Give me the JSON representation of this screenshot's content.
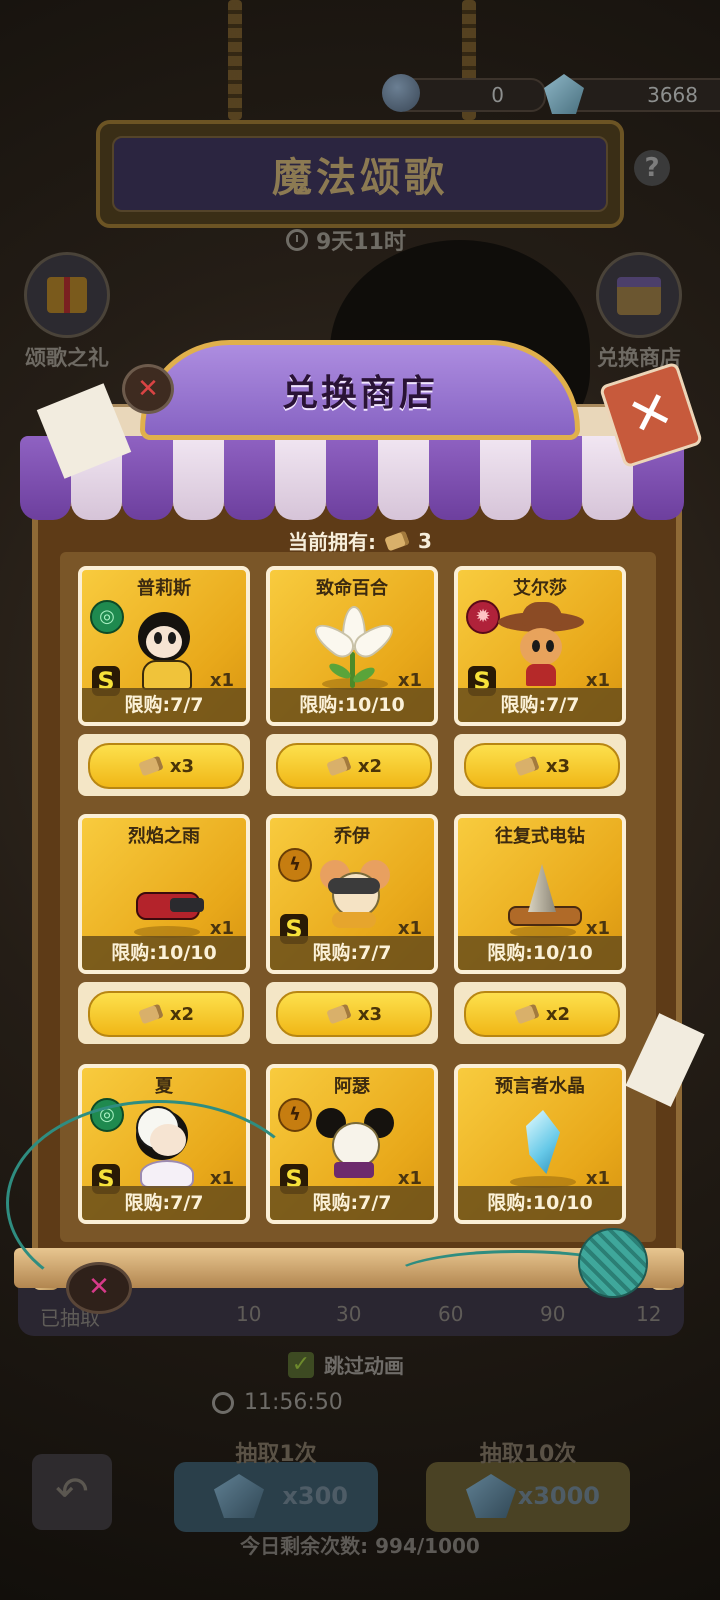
{
  "currency": {
    "orb_value": "0",
    "gem_value": "3668",
    "plus": "+"
  },
  "event": {
    "title": "魔法颂歌",
    "timer": "9天11时",
    "help": "?"
  },
  "side_buttons": {
    "left_label": "颂歌之礼",
    "right_label": "兑换商店"
  },
  "shop": {
    "title": "兑换商店",
    "owned_label": "当前拥有:",
    "owned_count": "3",
    "close_glyph": "✕",
    "items": [
      {
        "name": "普莉斯",
        "qty": "x1",
        "limit": "限购:7/7",
        "cost": "x3",
        "rank": "S",
        "element": "green"
      },
      {
        "name": "致命百合",
        "qty": "x1",
        "limit": "限购:10/10",
        "cost": "x2"
      },
      {
        "name": "艾尔莎",
        "qty": "x1",
        "limit": "限购:7/7",
        "cost": "x3",
        "rank": "S",
        "element": "red"
      },
      {
        "name": "烈焰之雨",
        "qty": "x1",
        "limit": "限购:10/10",
        "cost": "x2"
      },
      {
        "name": "乔伊",
        "qty": "x1",
        "limit": "限购:7/7",
        "cost": "x3",
        "rank": "S",
        "element": "gold"
      },
      {
        "name": "往复式电钻",
        "qty": "x1",
        "limit": "限购:10/10",
        "cost": "x2"
      },
      {
        "name": "夏",
        "qty": "x1",
        "limit": "限购:7/7",
        "rank": "S",
        "element": "green"
      },
      {
        "name": "阿瑟",
        "qty": "x1",
        "limit": "限购:7/7",
        "rank": "S",
        "element": "gold"
      },
      {
        "name": "预言者水晶",
        "qty": "x1",
        "limit": "限购:10/10"
      }
    ]
  },
  "progress": {
    "label": "已抽取",
    "milestones": [
      "10",
      "30",
      "60",
      "90",
      "12"
    ]
  },
  "bottom": {
    "skip_animation": "跳过动画",
    "refresh_timer": "11:56:50",
    "draw_one_label": "抽取1次",
    "draw_one_cost": "x300",
    "draw_ten_label": "抽取10次",
    "draw_ten_cost": "x3000",
    "remaining": "今日剩余次数: 994/1000"
  }
}
